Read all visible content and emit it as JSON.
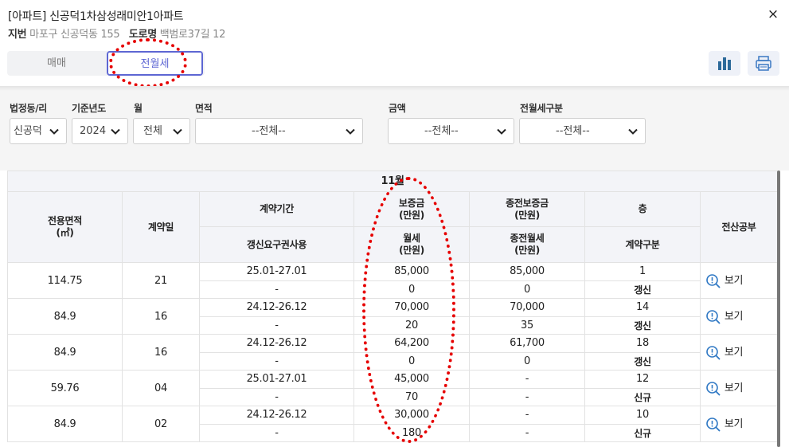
{
  "header": {
    "title": "[아파트] 신공덕1차삼성래미안1아파트",
    "jibun_label": "지번",
    "jibun_value": "마포구 신공덕동 155",
    "road_label": "도로명",
    "road_value": "백범로37길 12",
    "close_label": "×"
  },
  "tabs": [
    {
      "label": "매매",
      "active": false
    },
    {
      "label": "전월세",
      "active": true
    }
  ],
  "toolbar": {
    "chart_icon": "bar-chart-icon",
    "print_icon": "printer-icon"
  },
  "filters": {
    "dong": {
      "label": "법정동/리",
      "value": "신공덕"
    },
    "year": {
      "label": "기준년도",
      "value": "2024"
    },
    "month": {
      "label": "월",
      "value": "전체"
    },
    "area": {
      "label": "면적",
      "value": "--전체--"
    },
    "amount": {
      "label": "금액",
      "value": "--전체--"
    },
    "rent_type": {
      "label": "전월세구분",
      "value": "--전체--"
    }
  },
  "table": {
    "month_header": "11월",
    "headers": {
      "area": "전용면적\n(㎡)",
      "day": "계약일",
      "period": "계약기간",
      "renewal_right": "갱신요구권사용",
      "deposit": "보증금\n(만원)",
      "monthly_rent": "월세\n(만원)",
      "prev_deposit": "종전보증금\n(만원)",
      "prev_monthly_rent": "종전월세\n(만원)",
      "floor": "층",
      "contract_type": "계약구분",
      "registry": "전산공부"
    },
    "rows": [
      {
        "area": "114.75",
        "day": "21",
        "period": "25.01-27.01",
        "renewal": "-",
        "deposit": "85,000",
        "rent": "0",
        "prev_deposit": "85,000",
        "prev_rent": "0",
        "floor": "1",
        "type": "갱신",
        "view": "보기"
      },
      {
        "area": "84.9",
        "day": "16",
        "period": "24.12-26.12",
        "renewal": "-",
        "deposit": "70,000",
        "rent": "20",
        "prev_deposit": "70,000",
        "prev_rent": "35",
        "floor": "14",
        "type": "갱신",
        "view": "보기"
      },
      {
        "area": "84.9",
        "day": "16",
        "period": "24.12-26.12",
        "renewal": "-",
        "deposit": "64,200",
        "rent": "0",
        "prev_deposit": "61,700",
        "prev_rent": "0",
        "floor": "18",
        "type": "갱신",
        "view": "보기"
      },
      {
        "area": "59.76",
        "day": "04",
        "period": "25.01-27.01",
        "renewal": "-",
        "deposit": "45,000",
        "rent": "70",
        "prev_deposit": "-",
        "prev_rent": "-",
        "floor": "12",
        "type": "신규",
        "view": "보기"
      },
      {
        "area": "84.9",
        "day": "02",
        "period": "24.12-26.12",
        "renewal": "-",
        "deposit": "30,000",
        "rent": "180",
        "prev_deposit": "-",
        "prev_rent": "-",
        "floor": "10",
        "type": "신규",
        "view": "보기"
      }
    ]
  },
  "colors": {
    "accent": "#5d66d3",
    "annotation": "#e60000",
    "link": "#2f78c4"
  }
}
